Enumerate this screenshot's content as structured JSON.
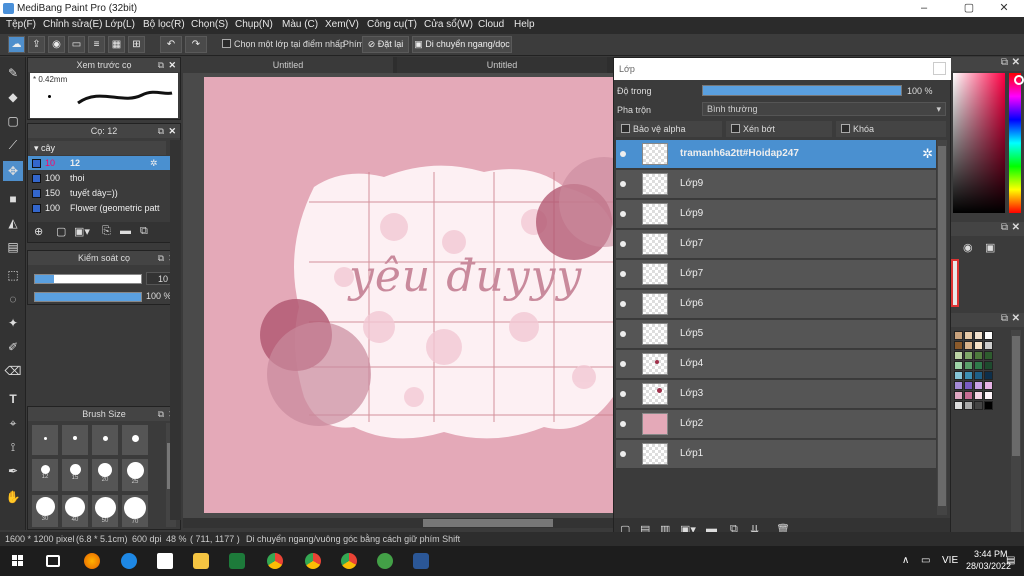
{
  "window": {
    "title": "MediBang Paint Pro (32bit)",
    "controls": [
      "–",
      "▢",
      "✕"
    ]
  },
  "menu": [
    "Tệp(F)",
    "Chỉnh sửa(E)",
    "Lớp(L)",
    "Bộ lọc(R)",
    "Chọn(S)",
    "Chụp(N)",
    "Màu (C)",
    "Xem(V)",
    "Công cụ(T)",
    "Cửa sổ(W)",
    "Cloud",
    "Help"
  ],
  "toolbar": {
    "select_layer_label": "Chọn một lớp tại điểm nhấp",
    "key_label": "Phím",
    "reset_label": "Đặt lại",
    "move_label": "Di chuyển ngang/dọc"
  },
  "brush_preview": {
    "title": "Xem trước cọ",
    "size": "0.42mm"
  },
  "brush_list": {
    "title": "Cọ: 12",
    "group": "cây",
    "items": [
      {
        "size": "10",
        "name": "12",
        "selected": true
      },
      {
        "size": "100",
        "name": "thoi"
      },
      {
        "size": "150",
        "name": "tuyết dày=))"
      },
      {
        "size": "100",
        "name": "Flower (geometric patt"
      }
    ]
  },
  "brush_control": {
    "title": "Kiểm soát cọ",
    "size_value": "10",
    "opacity_value": "100 %"
  },
  "brush_size": {
    "title": "Brush Size",
    "labels": [
      "",
      "",
      "",
      "",
      "12",
      "15",
      "20",
      "25",
      "30",
      "40",
      "50",
      "70"
    ]
  },
  "tabs": [
    "Untitled",
    "Untitled"
  ],
  "canvas": {
    "text": "yêu đuyyy"
  },
  "layers": {
    "title": "Lớp",
    "opacity_label": "Độ trong",
    "opacity_value": "100 %",
    "blend_label": "Pha trộn",
    "blend_value": "Bình thường",
    "protect_alpha": "Bảo vệ alpha",
    "clipping": "Xén bớt",
    "lock": "Khóa",
    "items": [
      {
        "name": "tramanh6a2tt#Hoidap247",
        "selected": true
      },
      {
        "name": "Lớp9"
      },
      {
        "name": "Lớp9"
      },
      {
        "name": "Lớp7"
      },
      {
        "name": "Lớp7"
      },
      {
        "name": "Lớp6"
      },
      {
        "name": "Lớp5"
      },
      {
        "name": "Lớp4"
      },
      {
        "name": "Lớp3"
      },
      {
        "name": "Lớp2"
      },
      {
        "name": "Lớp1"
      }
    ]
  },
  "status": {
    "size": "1600 * 1200 pixel",
    "dims": "(6.8 * 5.1cm)",
    "dpi": "600 dpi",
    "zoom": "48 %",
    "coords": "( 711, 1177 )",
    "hint": "Di chuyển ngang/vuông góc bằng cách giữ phím Shift"
  },
  "taskbar": {
    "language": "VIE",
    "time": "3:44 PM",
    "date": "28/03/2022"
  }
}
